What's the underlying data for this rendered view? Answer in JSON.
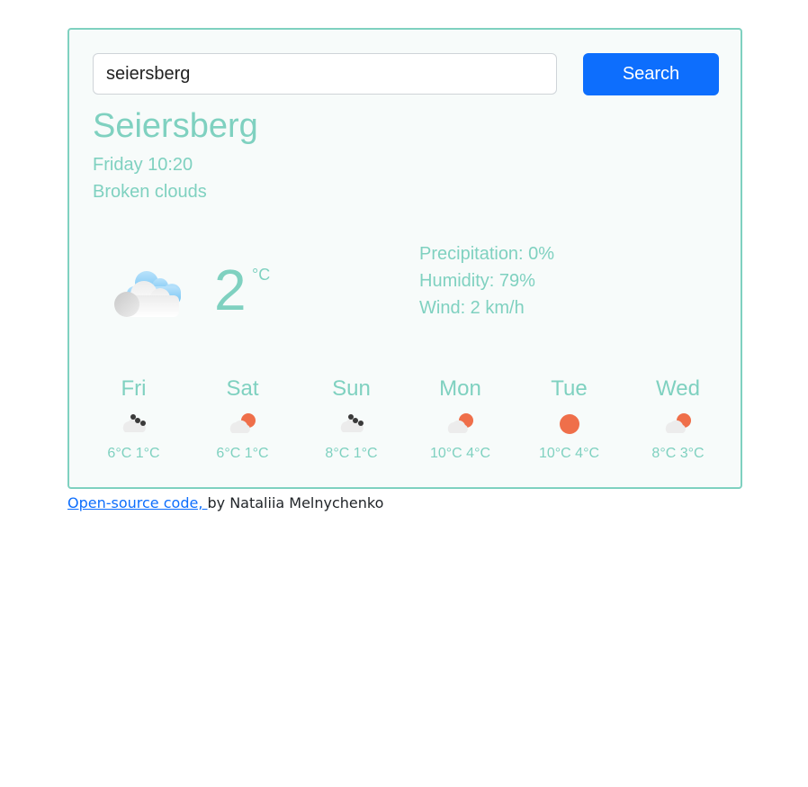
{
  "search": {
    "value": "seiersberg",
    "button_label": "Search"
  },
  "current": {
    "city": "Seiersberg",
    "datetime": "Friday 10:20",
    "description": "Broken clouds",
    "icon": "broken-clouds-icon",
    "temperature": "2",
    "unit": "°C",
    "precipitation": "Precipitation: 0%",
    "humidity": "Humidity: 79%",
    "wind": "Wind: 2 km/h"
  },
  "forecast": [
    {
      "day": "Fri",
      "icon": "rain-cloud-icon",
      "temps": "6°C 1°C"
    },
    {
      "day": "Sat",
      "icon": "partly-cloudy-icon",
      "temps": "6°C 1°C"
    },
    {
      "day": "Sun",
      "icon": "rain-cloud-icon",
      "temps": "8°C 1°C"
    },
    {
      "day": "Mon",
      "icon": "partly-cloudy-icon",
      "temps": "10°C 4°C"
    },
    {
      "day": "Tue",
      "icon": "sun-icon",
      "temps": "10°C 4°C"
    },
    {
      "day": "Wed",
      "icon": "partly-cloudy-icon",
      "temps": "8°C 3°C"
    }
  ],
  "footer": {
    "link_text": "Open-source code, ",
    "author_text": "by Nataliia Melnychenko"
  },
  "colors": {
    "accent": "#7fd1c0",
    "button": "#0d6efd",
    "sun": "#ef6f4a"
  }
}
